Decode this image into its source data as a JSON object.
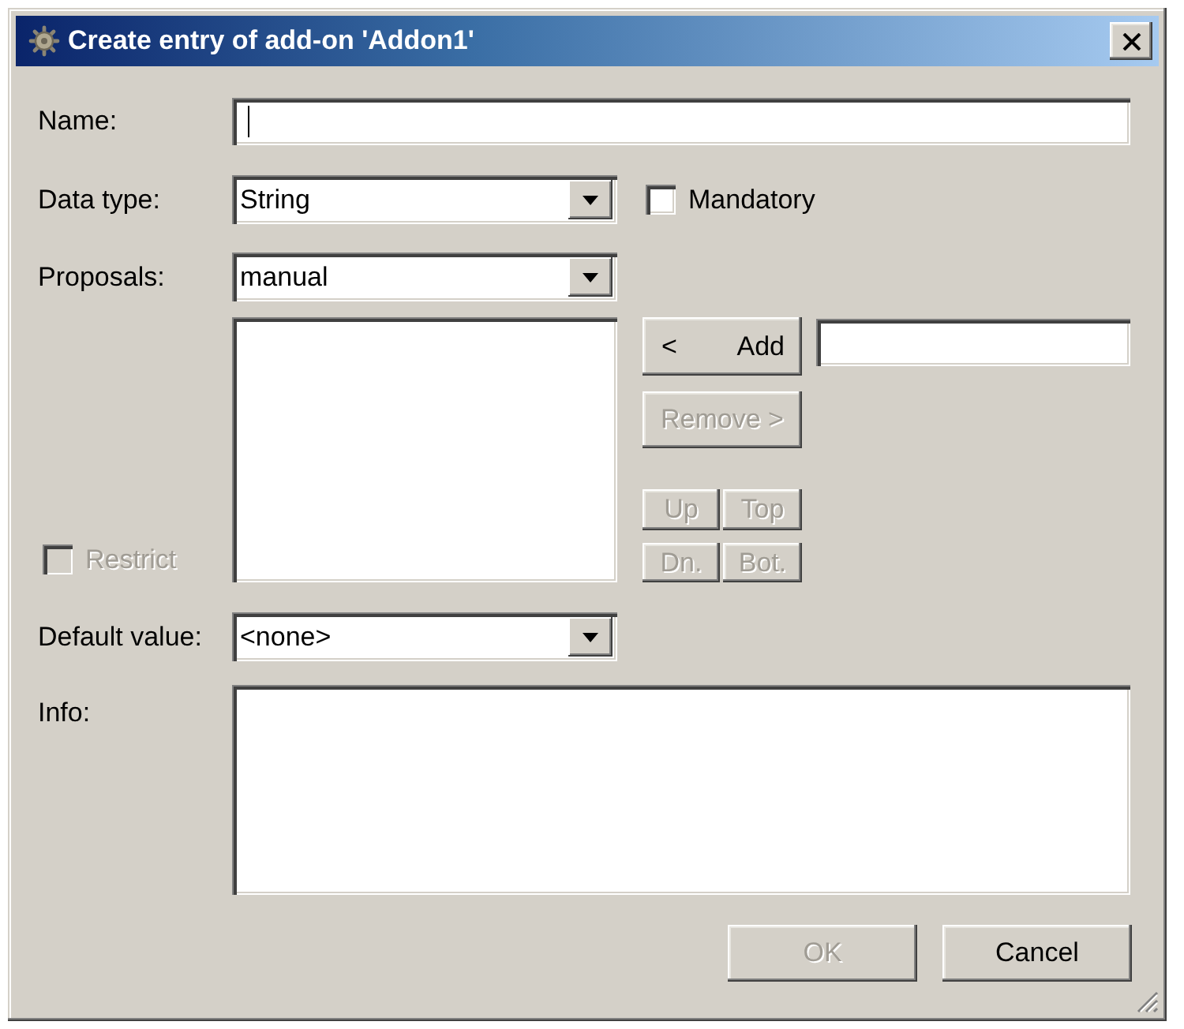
{
  "window": {
    "title": "Create entry of add-on 'Addon1'"
  },
  "name": {
    "label": "Name:",
    "focused": true
  },
  "data_type": {
    "label": "Data type:",
    "value": "String"
  },
  "mandatory": {
    "label": "Mandatory",
    "checked": false,
    "disabled": false
  },
  "proposals": {
    "label": "Proposals:",
    "value": "manual"
  },
  "add_button": {
    "arrow": "<",
    "label": "Add",
    "disabled": false
  },
  "remove_button": {
    "label": "Remove >",
    "disabled": true
  },
  "order_buttons": [
    {
      "label": "Up",
      "disabled": true
    },
    {
      "label": "Top",
      "disabled": true
    },
    {
      "label": "Dn.",
      "disabled": true
    },
    {
      "label": "Bot.",
      "disabled": true
    }
  ],
  "restrict": {
    "label": "Restrict",
    "checked": false,
    "disabled": true
  },
  "default_value": {
    "label": "Default value:",
    "value": "<none>"
  },
  "info": {
    "label": "Info:"
  },
  "buttons": [
    {
      "label": "OK",
      "disabled": true
    },
    {
      "label": "Cancel",
      "disabled": false
    }
  ]
}
